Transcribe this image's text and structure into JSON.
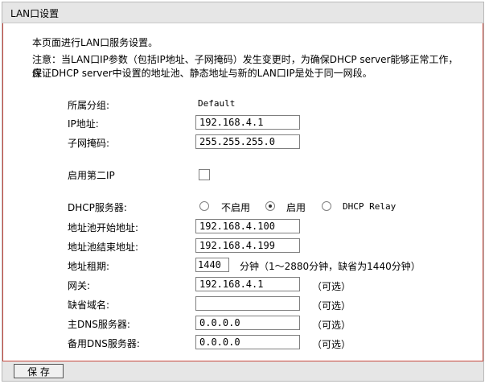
{
  "window": {
    "title": "LAN口设置"
  },
  "intro": "本页面进行LAN口服务设置。",
  "note_line1": "注意：当LAN口IP参数（包括IP地址、子网掩码）发生变更时，为确保DHCP server能够正常工作，应",
  "note_line2": "保证DHCP server中设置的地址池、静态地址与新的LAN口IP是处于同一网段。",
  "group": {
    "label": "所属分组:",
    "value": "Default"
  },
  "ip": {
    "label": "IP地址:",
    "value": "192.168.4.1"
  },
  "mask": {
    "label": "子网掩码:",
    "value": "255.255.255.0"
  },
  "second_ip": {
    "label": "启用第二IP",
    "checked": false
  },
  "dhcp": {
    "label": "DHCP服务器:",
    "options": [
      "不启用",
      "启用",
      "DHCP Relay"
    ],
    "selected": "启用"
  },
  "pool_start": {
    "label": "地址池开始地址:",
    "value": "192.168.4.100"
  },
  "pool_end": {
    "label": "地址池结束地址:",
    "value": "192.168.4.199"
  },
  "lease": {
    "label": "地址租期:",
    "value": "1440",
    "hint": "分钟（1～2880分钟，缺省为1440分钟）"
  },
  "gateway": {
    "label": "网关:",
    "value": "192.168.4.1",
    "hint": "（可选）"
  },
  "domain": {
    "label": "缺省域名:",
    "value": "",
    "hint": "（可选）"
  },
  "dns1": {
    "label": "主DNS服务器:",
    "value": "0.0.0.0",
    "hint": "（可选）"
  },
  "dns2": {
    "label": "备用DNS服务器:",
    "value": "0.0.0.0",
    "hint": "（可选）"
  },
  "save_label": "保 存",
  "colors": {
    "border_accent": "#c6473d",
    "bar_bg": "#e6e6e6"
  }
}
